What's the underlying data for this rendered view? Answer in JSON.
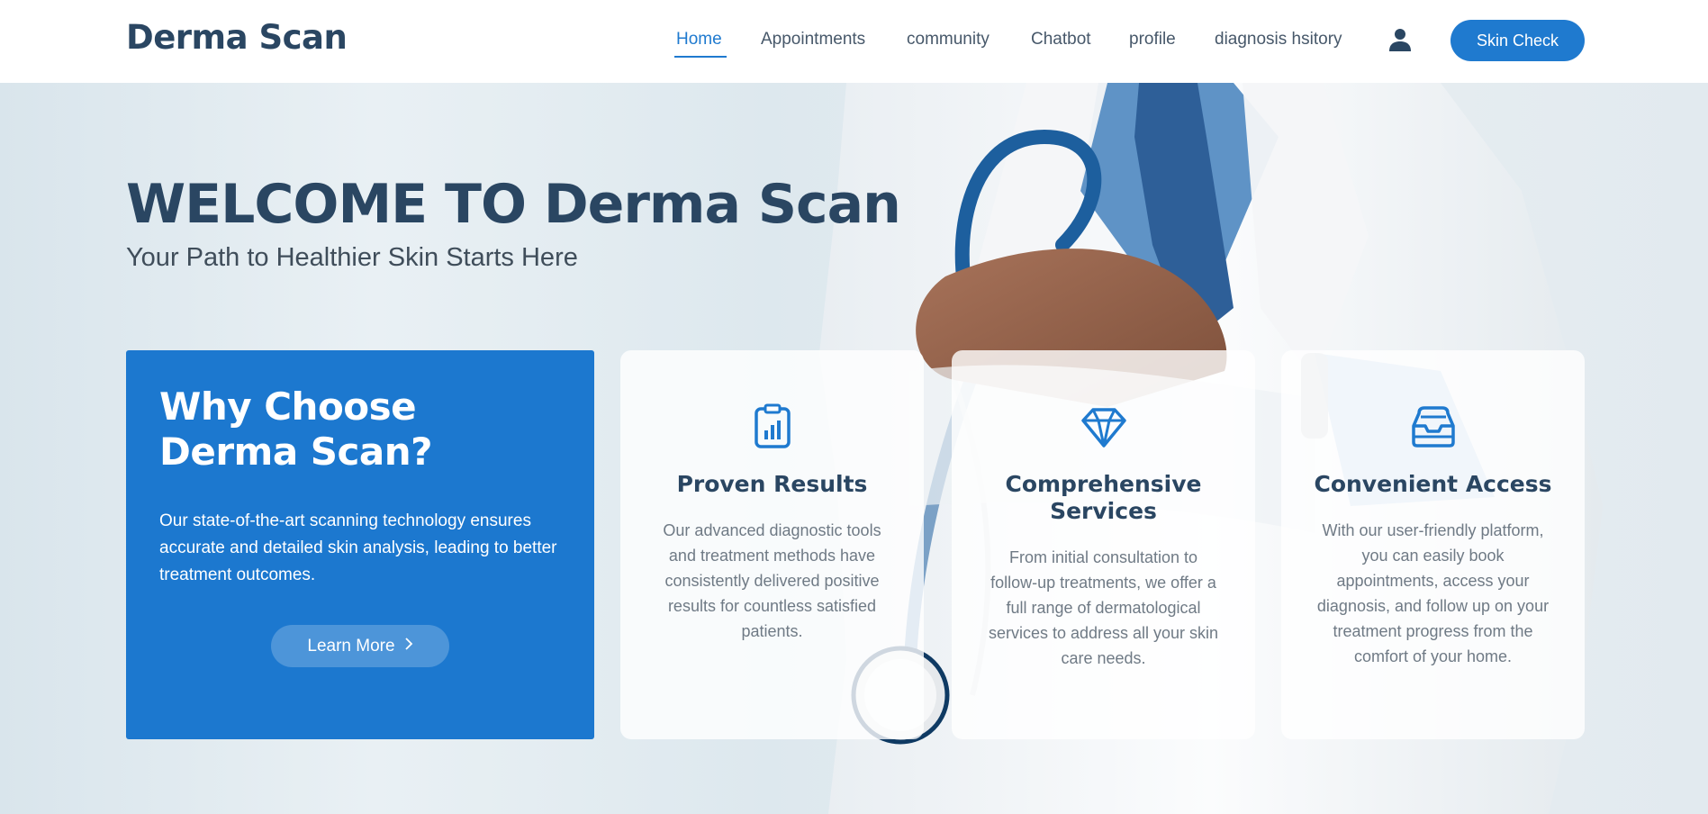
{
  "header": {
    "logo": "Derma Scan",
    "nav": [
      "Home",
      "Appointments",
      "community",
      "Chatbot",
      "profile",
      "diagnosis hsitory"
    ],
    "active_nav": "Home",
    "cta_label": "Skin Check",
    "user_icon": "user-icon"
  },
  "hero": {
    "title": "WELCOME TO Derma Scan",
    "subtitle": "Your Path to Healthier Skin Starts Here"
  },
  "why": {
    "title": "Why Choose Derma Scan?",
    "text": "Our state-of-the-art scanning technology ensures accurate and detailed skin analysis, leading to better treatment outcomes.",
    "button_label": "Learn More"
  },
  "features": [
    {
      "icon": "clipboard-chart-icon",
      "title": "Proven Results",
      "text": "Our advanced diagnostic tools and treatment methods have consistently delivered positive results for countless satisfied patients."
    },
    {
      "icon": "diamond-icon",
      "title": "Comprehensive Services",
      "text": "From initial consultation to follow-up treatments, we offer a full range of dermatological services to address all your skin care needs."
    },
    {
      "icon": "inbox-icon",
      "title": "Convenient Access",
      "text": "With our user-friendly platform, you can easily book appointments, access your diagnosis, and follow up on your treatment progress from the comfort of your home."
    }
  ],
  "colors": {
    "primary": "#1f7acf",
    "heading": "#2a4662",
    "body_text": "#6f7a85"
  }
}
